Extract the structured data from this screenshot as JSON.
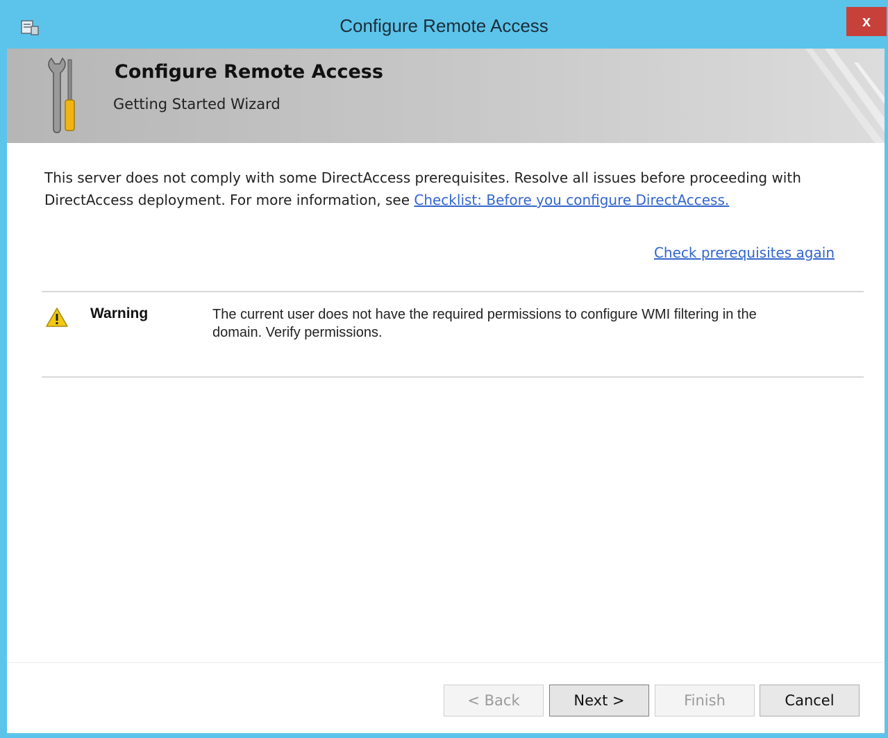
{
  "window": {
    "title": "Configure Remote Access",
    "close_label": "x"
  },
  "header": {
    "title": "Configure Remote Access",
    "subtitle": "Getting Started Wizard"
  },
  "intro": {
    "text": "This server does not comply with some DirectAccess prerequisites. Resolve all issues before proceeding with DirectAccess deployment. For more information, see ",
    "link_text": "Checklist: Before you configure DirectAccess."
  },
  "recheck_link": "Check prerequisites again",
  "issues": [
    {
      "severity": "Warning",
      "message": "The current user does not have the required permissions to configure WMI filtering in the domain. Verify permissions."
    }
  ],
  "buttons": {
    "back": "< Back",
    "next": "Next >",
    "finish": "Finish",
    "cancel": "Cancel"
  },
  "icons": {
    "app": "server-manager-icon",
    "header": "wrench-screwdriver-icon",
    "warning": "warning-triangle-icon",
    "close": "close-icon"
  },
  "colors": {
    "titlebar": "#5cc4ea",
    "close_button": "#c7403a",
    "link": "#3366cc",
    "warning_icon": "#f2c811"
  }
}
